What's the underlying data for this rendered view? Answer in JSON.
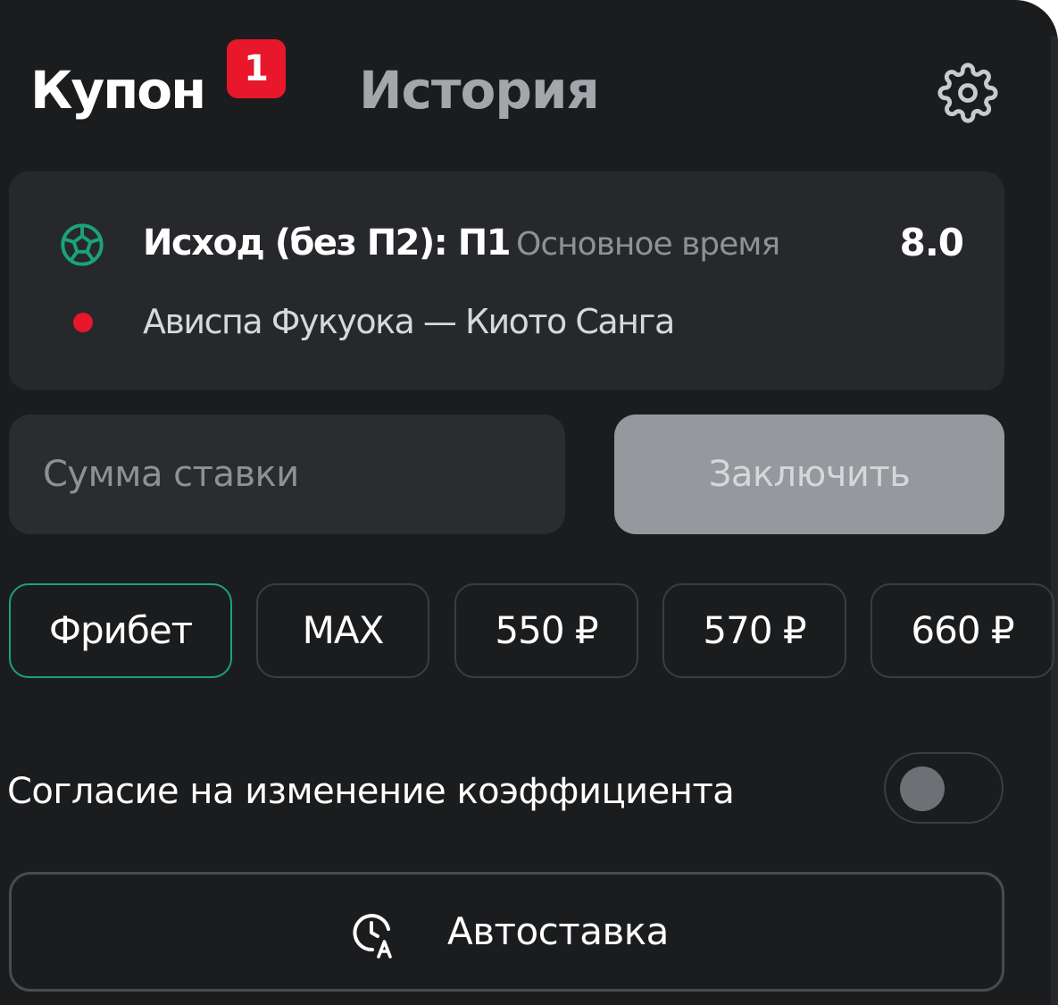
{
  "header": {
    "tabs": [
      {
        "label": "Купон",
        "active": true,
        "badge": "1"
      },
      {
        "label": "История",
        "active": false
      }
    ],
    "settings_icon": "gear-icon"
  },
  "bet": {
    "sport_icon": "soccer-ball-icon",
    "market": "Исход (без П2): П1",
    "period": "Основное время",
    "odds": "8.0",
    "live_indicator": "red-dot",
    "event": "Ависпа Фукуока — Киото Санга"
  },
  "stake": {
    "placeholder": "Сумма ставки",
    "submit_label": "Заключить"
  },
  "quick_amounts": [
    {
      "label": "Фрибет",
      "active": true
    },
    {
      "label": "MAX",
      "active": false
    },
    {
      "label": "550 ₽",
      "active": false
    },
    {
      "label": "570 ₽",
      "active": false
    },
    {
      "label": "660 ₽",
      "active": false
    }
  ],
  "odds_change": {
    "label": "Согласие на изменение коэффициента",
    "enabled": false
  },
  "autobet": {
    "icon": "clock-auto-icon",
    "label": "Автоставка"
  },
  "colors": {
    "background": "#1b1c1e",
    "card": "#27282b",
    "badge": "#e8172c",
    "accent_green": "#1aa37a",
    "submit_disabled": "#96989d"
  }
}
